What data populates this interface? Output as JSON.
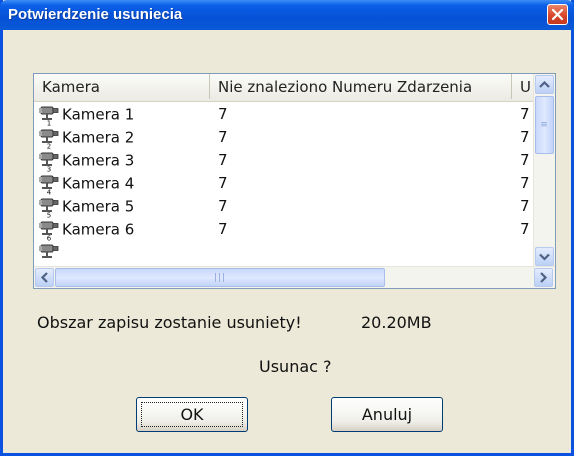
{
  "dialog": {
    "title": "Potwierdzenie usuniecia",
    "close_icon": "close-x-icon"
  },
  "table": {
    "columns": [
      "Kamera",
      "Nie znaleziono Numeru Zdarzenia",
      "U"
    ],
    "rows": [
      {
        "icon": "camera-icon",
        "name": "Kamera 1",
        "not_found": "7",
        "u": "7"
      },
      {
        "icon": "camera-icon",
        "name": "Kamera 2",
        "not_found": "7",
        "u": "7"
      },
      {
        "icon": "camera-icon",
        "name": "Kamera 3",
        "not_found": "7",
        "u": "7"
      },
      {
        "icon": "camera-icon",
        "name": "Kamera 4",
        "not_found": "7",
        "u": "7"
      },
      {
        "icon": "camera-icon",
        "name": "Kamera 5",
        "not_found": "7",
        "u": "7"
      },
      {
        "icon": "camera-icon",
        "name": "Kamera 6",
        "not_found": "7",
        "u": "7"
      }
    ]
  },
  "message": {
    "text": "Obszar zapisu zostanie usuniety!",
    "size": "20.20MB",
    "question": "Usunac ?"
  },
  "buttons": {
    "ok": "OK",
    "cancel": "Anuluj"
  },
  "colors": {
    "titlebar": "#0651d6",
    "close_button": "#d8452b",
    "dialog_bg": "#ece9d8"
  }
}
